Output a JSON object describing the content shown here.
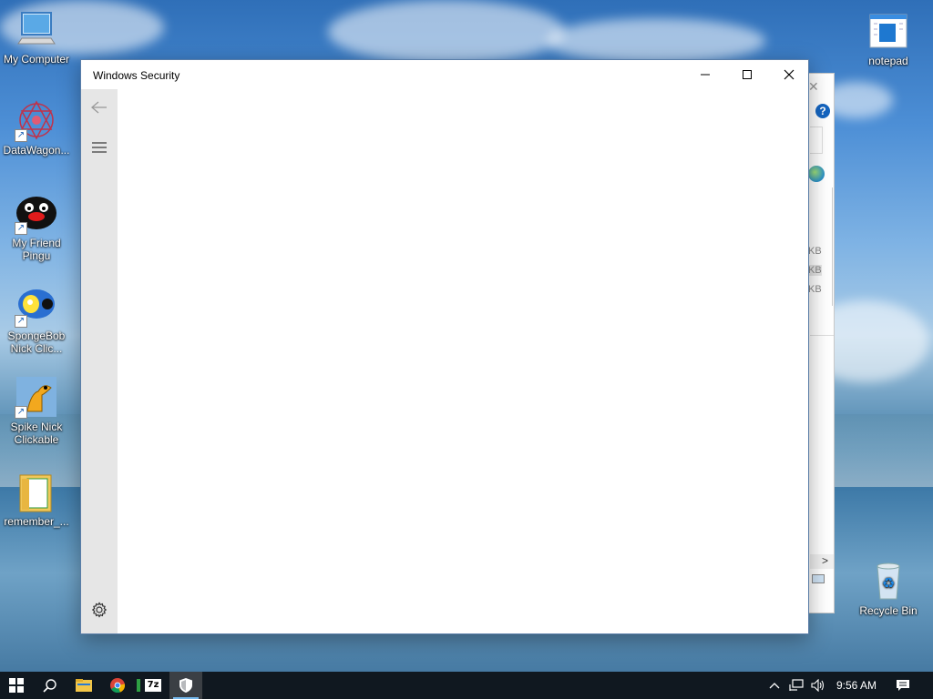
{
  "desktop": {
    "icons": [
      {
        "label": "My Computer",
        "icon": "computer-icon"
      },
      {
        "label": "DataWagon...",
        "icon": "datawagon-icon"
      },
      {
        "label": "My Friend Pingu",
        "icon": "pingu-icon"
      },
      {
        "label": "SpongeBob Nick Clic...",
        "icon": "spongebob-icon"
      },
      {
        "label": "Spike Nick Clickable",
        "icon": "spike-icon"
      },
      {
        "label": "remember_...",
        "icon": "folder-icon"
      },
      {
        "label": "notepad",
        "icon": "notepad-icon"
      },
      {
        "label": "Recycle Bin",
        "icon": "recycle-bin-icon"
      }
    ]
  },
  "background_window": {
    "help_glyph": "?",
    "close_glyph": "✕",
    "sizes": [
      "KB",
      "KB",
      "KB"
    ],
    "scroll_glyph": ">"
  },
  "window": {
    "title": "Windows Security",
    "accent": "#e6e6e6"
  },
  "taskbar": {
    "apps": [
      {
        "name": "start",
        "icon": "windows-logo-icon"
      },
      {
        "name": "search",
        "icon": "search-icon"
      },
      {
        "name": "file-explorer",
        "icon": "folder-icon"
      },
      {
        "name": "chrome",
        "icon": "chrome-icon"
      },
      {
        "name": "7zip",
        "icon": "7zip-icon",
        "label": "7z"
      },
      {
        "name": "windows-security",
        "icon": "shield-icon"
      }
    ],
    "clock": "9:56 AM"
  }
}
